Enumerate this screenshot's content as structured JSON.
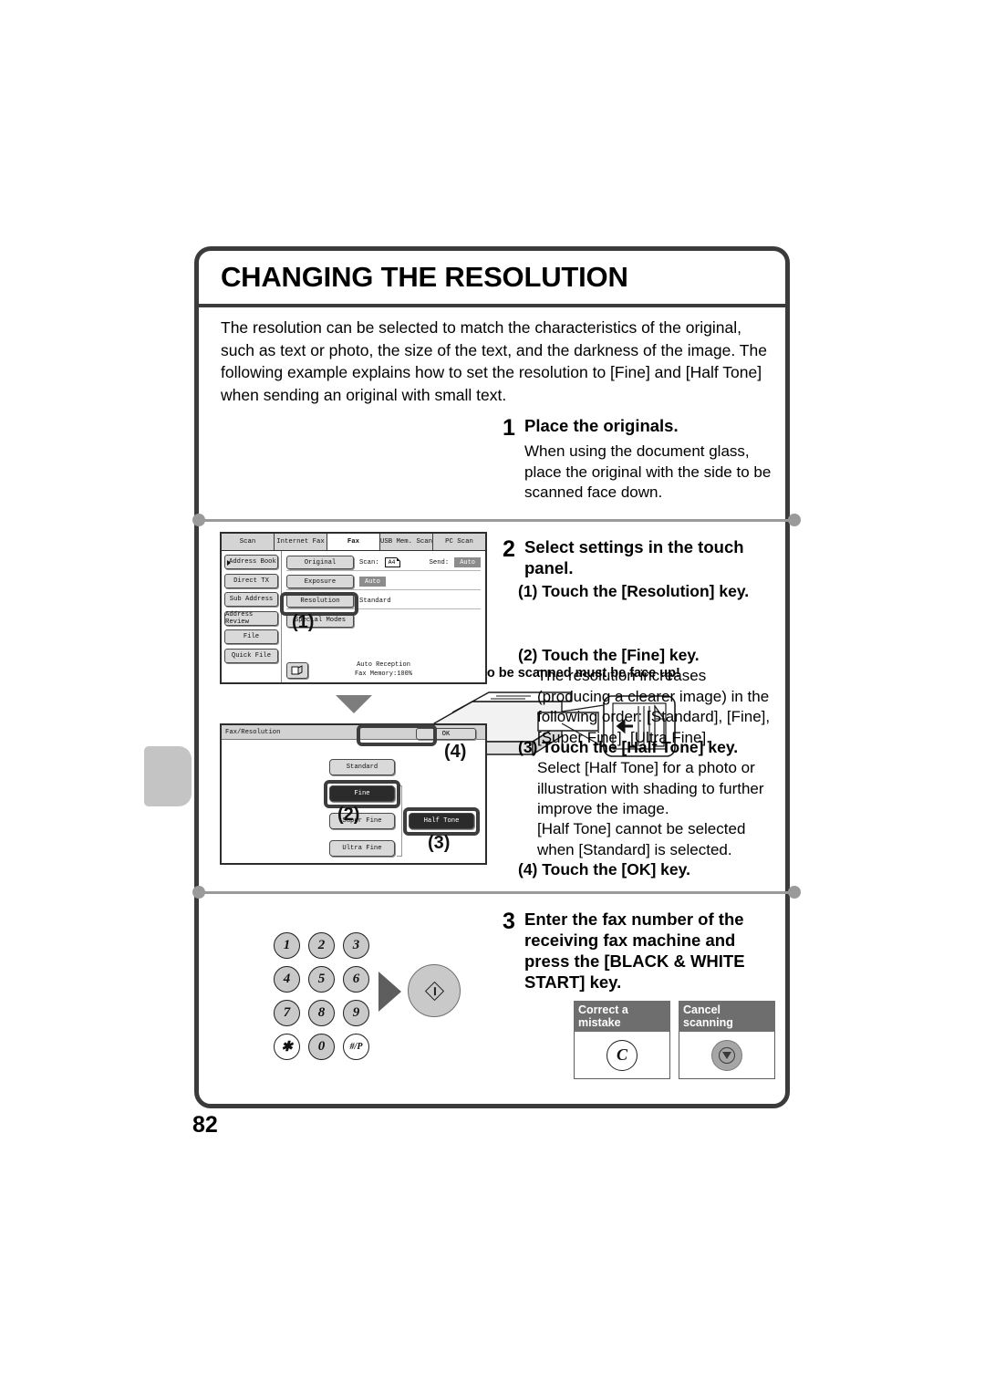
{
  "page": {
    "number": "82",
    "title": "CHANGING THE RESOLUTION",
    "intro": "The resolution can be selected to match the characteristics of the original, such as text or photo, the size of the text, and the darkness of the image. The following example explains how to set the resolution to [Fine] and [Half Tone] when sending an original with small text."
  },
  "step1": {
    "number": "1",
    "heading": "Place the originals.",
    "body": "When using the document glass, place the original with the side to be scanned face down.",
    "illustration_note": "The side to be scanned must be face up!"
  },
  "step2": {
    "number": "2",
    "heading": "Select settings in the touch panel.",
    "sub1": "(1) Touch the [Resolution] key.",
    "sub2": "(2) Touch the [Fine] key.",
    "sub2_body": "The resolution increases (producing a clearer image) in the following order: [Standard], [Fine], [Super Fine], [Ultra Fine].",
    "sub3": "(3) Touch the [Half Tone] key.",
    "sub3_body1": "Select [Half Tone] for a photo or illustration with shading to further improve the image.",
    "sub3_body2": "[Half Tone] cannot be selected when [Standard] is selected.",
    "sub4": "(4) Touch the [OK] key."
  },
  "step3": {
    "number": "3",
    "heading": "Enter the fax number of the receiving fax machine and press the [BLACK & WHITE START] key."
  },
  "fax_screen": {
    "tabs": [
      {
        "label": "Scan",
        "active": false
      },
      {
        "label": "Internet Fax",
        "active": false
      },
      {
        "label": "Fax",
        "active": true
      },
      {
        "label": "USB Mem. Scan",
        "active": false
      },
      {
        "label": "PC Scan",
        "active": false
      }
    ],
    "side_keys": [
      "Address Book",
      "Direct TX",
      "Sub Address",
      "Address Review",
      "File",
      "Quick File"
    ],
    "rows": {
      "original_key": "Original",
      "scan_label": "Scan:",
      "scan_value": "A4",
      "send_label": "Send:",
      "send_value": "Auto",
      "exposure_key": "Exposure",
      "exposure_value": "Auto",
      "resolution_key": "Resolution",
      "resolution_value": "Standard",
      "special_modes_key": "Special Modes"
    },
    "status": {
      "line1": "Auto Reception",
      "line2": "Fax Memory:100%"
    },
    "callout": "(1)"
  },
  "resolution_dialog": {
    "title": "Fax/Resolution",
    "ok_label": "OK",
    "keys": [
      {
        "label": "Standard",
        "selected": false
      },
      {
        "label": "Fine",
        "selected": true
      },
      {
        "label": "Super Fine",
        "selected": false
      },
      {
        "label": "Ultra Fine",
        "selected": false
      }
    ],
    "half_tone_key": {
      "label": "Half Tone",
      "selected": true
    },
    "callouts": {
      "fine": "(2)",
      "half_tone": "(3)",
      "ok": "(4)"
    }
  },
  "keypad": {
    "keys": [
      "1",
      "2",
      "3",
      "4",
      "5",
      "6",
      "7",
      "8",
      "9",
      "✱",
      "0",
      "#/P"
    ]
  },
  "controls": [
    {
      "caption": "Correct a mistake",
      "glyph": "C"
    },
    {
      "caption": "Cancel scanning",
      "glyph": "stop"
    }
  ]
}
